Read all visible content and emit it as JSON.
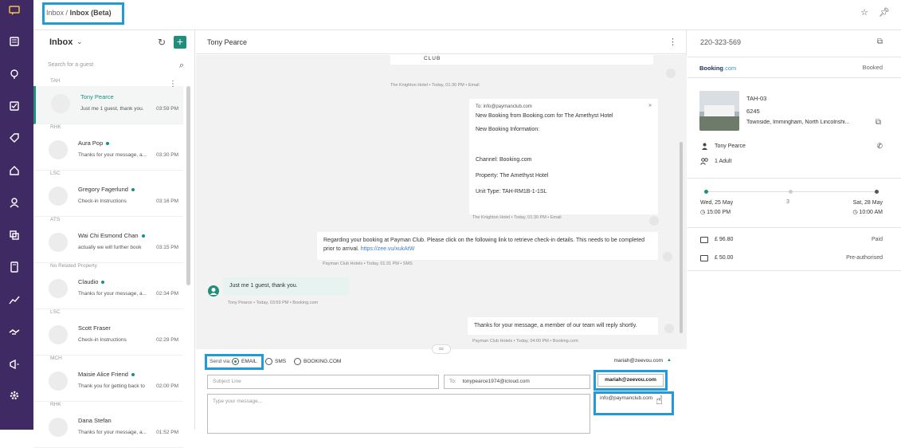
{
  "breadcrumb": {
    "parent": "Inbox",
    "separator": "/",
    "current": "Inbox (Beta)"
  },
  "inbox": {
    "title": "Inbox",
    "search_placeholder": "Search for a guest",
    "conversations": [
      {
        "group": "TAH",
        "name": "Tony Pearce",
        "preview": "Just me 1 guest, thank you.",
        "time": "03:59 PM",
        "online": false,
        "selected": true
      },
      {
        "group": "RHK",
        "name": "Aura Pop",
        "preview": "Thanks for your message, a...",
        "time": "03:30 PM",
        "online": true,
        "selected": false
      },
      {
        "group": "LSC",
        "name": "Gregory Fagerlund",
        "preview": "Check-in Instructions",
        "time": "03:16 PM",
        "online": true,
        "selected": false
      },
      {
        "group": "ATS",
        "name": "Wai Chi Esmond Chan",
        "preview": "actually we will further book",
        "time": "03:15 PM",
        "online": true,
        "selected": false
      },
      {
        "group": "No Related Property",
        "name": "Claudio",
        "preview": "Thanks for your message, a...",
        "time": "02:34 PM",
        "online": true,
        "selected": false
      },
      {
        "group": "LSC",
        "name": "Scott Fraser",
        "preview": "Check-in Instructions",
        "time": "02:29 PM",
        "online": false,
        "selected": false
      },
      {
        "group": "MCH",
        "name": "Maisie Alice Friend",
        "preview": "Thank you for getting back to",
        "time": "02:00 PM",
        "online": true,
        "selected": false
      },
      {
        "group": "RHK",
        "name": "Dana Stefan",
        "preview": "Thanks for your message, a...",
        "time": "01:52 PM",
        "online": false,
        "selected": false
      }
    ]
  },
  "conversation": {
    "guest_name": "Tony Pearce",
    "messages": {
      "m0": {
        "body": "CLUB",
        "meta": "The Knighton Hotel • Today, 01:30 PM • Email"
      },
      "m1": {
        "to": "To: info@paymanclub.com",
        "subject": "New Booking from Booking.com for The Amethyst Hotel",
        "info_heading": "New Booking Information:",
        "channel_label": "Channel:",
        "channel_value": "Booking.com",
        "property_label": "Property:",
        "property_value": "The Amethyst Hotel",
        "unit_label": "Unit Type:",
        "unit_value": "TAH-RM1B-1-1SL",
        "meta": "The Knighton Hotel • Today, 01:30 PM • Email"
      },
      "m2": {
        "body": "Regarding your booking at Payman Club. Please click on the following link to retrieve check-in details. This needs to be completed prior to arrival.",
        "link": "https://zee.vu/xukAtW",
        "meta": "Payman Club Hotels • Today, 01:31 PM • SMS"
      },
      "m3": {
        "body": "Just me 1 guest, thank you.",
        "meta": "Tony Pearce • Today, 03:59 PM • Booking.com"
      },
      "m4": {
        "body": "Thanks for your message, a member of our team will reply shortly.",
        "meta": "Payman Club Hotels • Today, 04:00 PM • Booking.com"
      }
    }
  },
  "composer": {
    "send_via_label": "Send via:",
    "channels": {
      "email": "EMAIL",
      "sms": "SMS",
      "booking": "BOOKING.COM"
    },
    "selected_channel": "EMAIL",
    "from_address": "mariah@zeevou.com",
    "subject_placeholder": "Subject Line",
    "to_prefix": "To:",
    "to_value": "tonypearce1974@icloud.com",
    "from_options": {
      "first": "mariah@zeevou.com",
      "second": "info@paymanclub.com"
    },
    "message_placeholder": "Type your message..."
  },
  "details": {
    "phone": "220-323-569",
    "channel_brand_main": "Booking",
    "channel_brand_suffix": ".com",
    "status": "Booked",
    "unit_code": "TAH-03",
    "unit_number": "6245",
    "address": "Townside, Immingham, North Lincolnshi...",
    "guest_name": "Tony Pearce",
    "guests": "1 Adult",
    "checkin_date": "Wed, 25 May",
    "checkin_time": "15:00 PM",
    "nights": "3",
    "checkout_date": "Sat, 28 May",
    "checkout_time": "10:00 AM",
    "amounts": {
      "first": {
        "value": "£ 96.80",
        "status": "Paid"
      },
      "second": {
        "value": "£ 50.00",
        "status": "Pre-authorised"
      }
    }
  },
  "colors": {
    "sidebar": "#3f2a63",
    "accent": "#1f8f7c",
    "highlight": "#1e9bd8",
    "link": "#3a7bd5"
  },
  "icons": {
    "rail": [
      "inbox-icon",
      "list-icon",
      "location-icon",
      "checklist-icon",
      "tag-icon",
      "home-icon",
      "user-icon",
      "copy-icon",
      "calculator-icon",
      "chart-icon",
      "handshake-icon",
      "megaphone-icon",
      "settings-icon"
    ],
    "top": [
      "star-icon",
      "pin-icon"
    ]
  }
}
